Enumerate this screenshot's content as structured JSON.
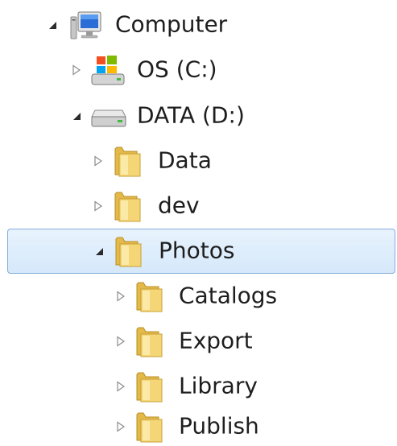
{
  "tree": {
    "items": [
      {
        "label": "Computer",
        "level": 0,
        "expanded": true,
        "icon": "computer-icon"
      },
      {
        "label": "OS (C:)",
        "level": 1,
        "expanded": false,
        "icon": "windows-drive-icon"
      },
      {
        "label": "DATA (D:)",
        "level": 1,
        "expanded": true,
        "icon": "hard-drive-icon"
      },
      {
        "label": "Data",
        "level": 2,
        "expanded": false,
        "icon": "folder-icon"
      },
      {
        "label": "dev",
        "level": 2,
        "expanded": false,
        "icon": "folder-icon"
      },
      {
        "label": "Photos",
        "level": 2,
        "expanded": true,
        "selected": true,
        "icon": "folder-icon"
      },
      {
        "label": "Catalogs",
        "level": 3,
        "expanded": false,
        "icon": "folder-icon"
      },
      {
        "label": "Export",
        "level": 3,
        "expanded": false,
        "icon": "folder-icon"
      },
      {
        "label": "Library",
        "level": 3,
        "expanded": false,
        "icon": "folder-icon"
      },
      {
        "label": "Publish",
        "level": 3,
        "expanded": false,
        "icon": "folder-icon"
      }
    ]
  },
  "colors": {
    "selection_fill": "#d9ebfb",
    "selection_border": "#84acdd",
    "text": "#1e1e1e",
    "folder": "#f4d676"
  }
}
